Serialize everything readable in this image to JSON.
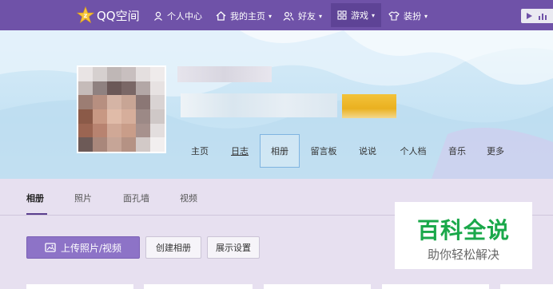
{
  "topnav": {
    "brand": "QQ空间",
    "items": [
      {
        "label": "个人中心",
        "icon": "user-icon"
      },
      {
        "label": "我的主页",
        "icon": "home-icon"
      },
      {
        "label": "好友",
        "icon": "friends-icon"
      },
      {
        "label": "游戏",
        "icon": "grid-icon"
      },
      {
        "label": "装扮",
        "icon": "shirt-icon"
      }
    ]
  },
  "profile": {
    "tabs": [
      "主页",
      "日志",
      "相册",
      "留言板",
      "说说",
      "个人档",
      "音乐",
      "更多"
    ],
    "active_tab": "相册"
  },
  "album": {
    "subtabs": [
      "相册",
      "照片",
      "面孔墙",
      "视频"
    ],
    "active_subtab": "相册",
    "upload_button": "上传照片/视频",
    "create_button": "创建相册",
    "display_settings_button": "展示设置"
  },
  "watermark": {
    "title": "百科全说",
    "subtitle": "助你轻松解决"
  },
  "colors": {
    "nav_bg": "#6f52a8",
    "primary_button": "#8d73c7",
    "watermark_green": "#1aa84a"
  }
}
